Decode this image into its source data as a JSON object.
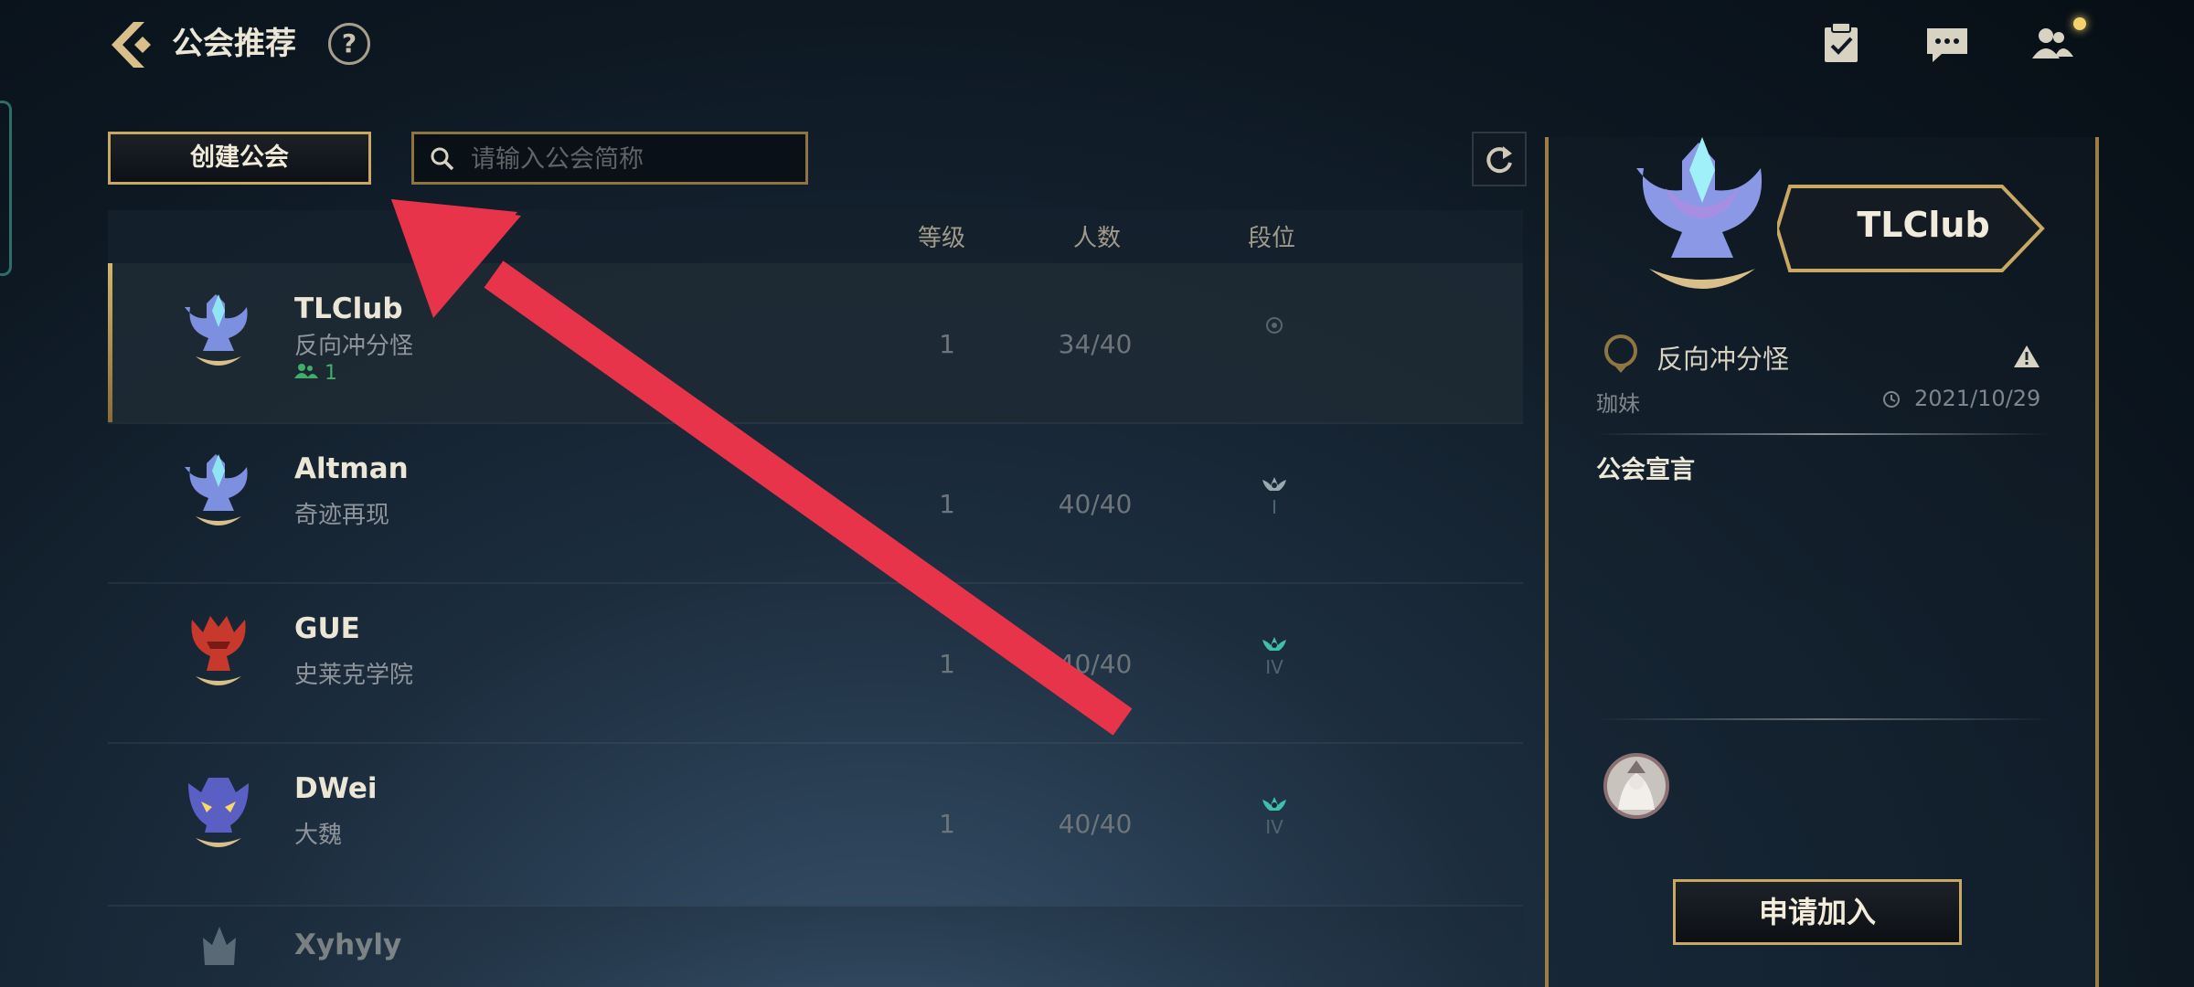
{
  "header": {
    "title": "公会推荐",
    "help_label": "?"
  },
  "toolbar": {
    "create_label": "创建公会",
    "search_placeholder": "请输入公会简称"
  },
  "list": {
    "columns": [
      "等级",
      "人数",
      "段位"
    ],
    "rows": [
      {
        "name": "TLClub",
        "desc": "反向冲分怪",
        "online": "1",
        "level": "1",
        "members": "34/40",
        "rank": "",
        "selected": true,
        "emblem_color": "#6f7fd6"
      },
      {
        "name": "Altman",
        "desc": "奇迹再现",
        "online": "",
        "level": "1",
        "members": "40/40",
        "rank": "I",
        "selected": false,
        "emblem_color": "#6f7fd6"
      },
      {
        "name": "GUE",
        "desc": "史莱克学院",
        "online": "",
        "level": "1",
        "members": "40/40",
        "rank": "IV",
        "selected": false,
        "emblem_color": "#c7392c"
      },
      {
        "name": "DWei",
        "desc": "大魏",
        "online": "",
        "level": "1",
        "members": "40/40",
        "rank": "IV",
        "selected": false,
        "emblem_color": "#5a5fc4"
      },
      {
        "name": "Xyhyly",
        "desc": "",
        "online": "",
        "level": "",
        "members": "",
        "rank": "",
        "selected": false,
        "emblem_color": "#8b98a4"
      }
    ]
  },
  "panel": {
    "guild_name": "TLClub",
    "owner_desc": "反向冲分怪",
    "owner_name": "珈妹",
    "date": "2021/10/29",
    "declaration_title": "公会宣言",
    "declaration": "",
    "apply_label": "申请加入"
  },
  "colors": {
    "gold": "#c8a862",
    "arrow": "#e8344a",
    "online": "#3fae6b"
  },
  "icons": [
    "back-icon",
    "help-icon",
    "task-icon",
    "chat-icon",
    "friends-icon",
    "search-icon",
    "refresh-icon",
    "warning-icon",
    "clock-icon"
  ]
}
